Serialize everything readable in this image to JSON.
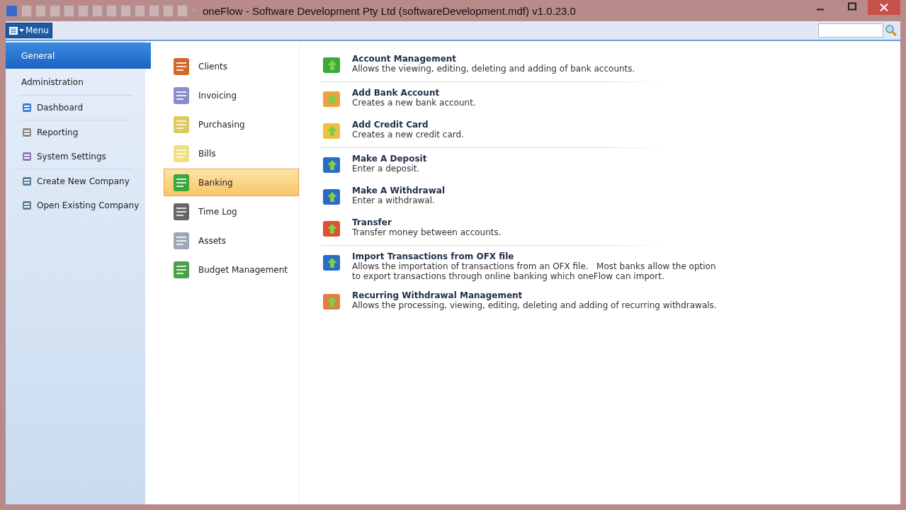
{
  "window": {
    "title": "oneFlow - Software Development Pty Ltd (softwareDevelopment.mdf) v1.0.23.0"
  },
  "menu_button": {
    "label": "Menu"
  },
  "sidebar": {
    "groups": [
      {
        "items": [
          {
            "label": "General",
            "kind": "section",
            "selected": true
          },
          {
            "label": "Administration",
            "kind": "section",
            "selected": false
          }
        ]
      },
      {
        "items": [
          {
            "label": "Dashboard",
            "kind": "icon-item",
            "selected": false
          }
        ]
      },
      {
        "items": [
          {
            "label": "Reporting",
            "kind": "icon-item",
            "selected": false
          },
          {
            "label": "System Settings",
            "kind": "icon-item",
            "selected": false
          }
        ]
      },
      {
        "items": [
          {
            "label": "Create New Company",
            "kind": "icon-item",
            "selected": false
          },
          {
            "label": "Open Existing Company",
            "kind": "icon-item",
            "selected": false
          }
        ]
      }
    ]
  },
  "modules": [
    {
      "label": "Clients",
      "selected": false
    },
    {
      "label": "Invoicing",
      "selected": false
    },
    {
      "label": "Purchasing",
      "selected": false
    },
    {
      "label": "Bills",
      "selected": false
    },
    {
      "label": "Banking",
      "selected": true
    },
    {
      "label": "Time Log",
      "selected": false
    },
    {
      "label": "Assets",
      "selected": false
    },
    {
      "label": "Budget Management",
      "selected": false
    }
  ],
  "action_groups": [
    {
      "actions": [
        {
          "title": "Account Management",
          "lines": [
            "Allows the viewing, editing, deleting and adding of bank accounts."
          ]
        }
      ]
    },
    {
      "actions": [
        {
          "title": "Add Bank Account",
          "lines": [
            "Creates a new bank account."
          ]
        },
        {
          "title": "Add Credit Card",
          "lines": [
            "Creates a new credit card."
          ]
        }
      ]
    },
    {
      "actions": [
        {
          "title": "Make A Deposit",
          "lines": [
            "Enter a deposit."
          ]
        },
        {
          "title": "Make A Withdrawal",
          "lines": [
            "Enter a withdrawal."
          ]
        },
        {
          "title": "Transfer",
          "lines": [
            "Transfer money between accounts."
          ]
        }
      ]
    },
    {
      "actions": [
        {
          "title": "Import Transactions from OFX file",
          "lines": [
            "Allows the importation of transactions from an OFX file.   Most banks allow the option",
            "to export transactions through online banking which oneFlow can import."
          ]
        },
        {
          "title": "Recurring Withdrawal Management",
          "lines": [
            "Allows the processing, viewing, editing, deleting and adding of recurring withdrawals."
          ]
        }
      ]
    }
  ]
}
